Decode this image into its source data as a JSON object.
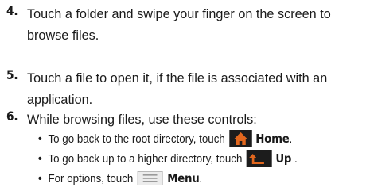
{
  "steps": [
    {
      "number": "4.",
      "text": "Touch a folder and swipe your finger on the screen to browse files."
    },
    {
      "number": "5.",
      "text": "Touch a file to open it, if the file is associated with an application."
    },
    {
      "number": "6.",
      "text": "While browsing files, use these controls:"
    }
  ],
  "controls": [
    {
      "text": "To go back to the root directory, touch",
      "icon": "home-icon",
      "label": "Home",
      "suffix": "."
    },
    {
      "text": "To go back up to a higher directory, touch",
      "icon": "up-icon",
      "label": "Up",
      "suffix": "."
    },
    {
      "text": "For options, touch",
      "icon": "menu-icon",
      "label": "Menu",
      "suffix": "."
    }
  ],
  "icon_colors": {
    "accent": "#e2671e",
    "dark": "#1c1c1c",
    "menu_lines": "#9a9a9a"
  }
}
